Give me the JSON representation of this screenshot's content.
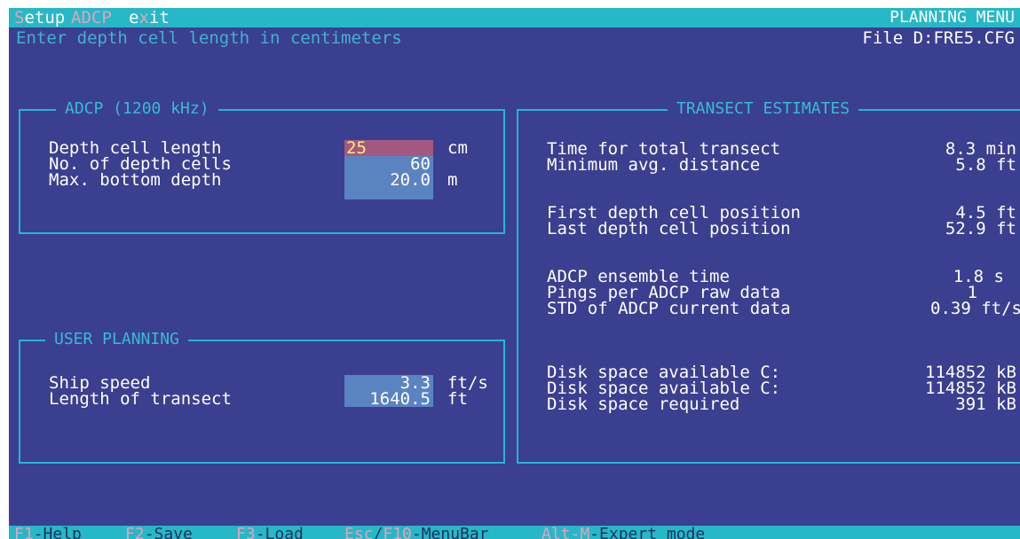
{
  "menu": {
    "setup_hot": "S",
    "setup_rest": "etup",
    "adcp": "ADCP",
    "exit_a": "e",
    "exit_hot": "x",
    "exit_b": "it",
    "title": "PLANNING MENU"
  },
  "hint": "Enter depth cell length in centimeters",
  "file": "File D:FRE5.CFG",
  "adcp_panel": {
    "title": "ADCP (1200 kHz)",
    "rows": [
      {
        "label": "Depth cell length",
        "value": "25",
        "unit": "cm"
      },
      {
        "label": "No. of depth cells",
        "value": "60",
        "unit": ""
      },
      {
        "label": "Max. bottom depth",
        "value": "20.0",
        "unit": "m"
      }
    ]
  },
  "user_panel": {
    "title": "USER PLANNING",
    "rows": [
      {
        "label": "Ship speed",
        "value": "3.3",
        "unit": "ft/s"
      },
      {
        "label": "Length of transect",
        "value": "1640.5",
        "unit": "ft"
      }
    ]
  },
  "transect_panel": {
    "title": "TRANSECT ESTIMATES",
    "rows": [
      {
        "label": "Time for total transect",
        "value": "8.3 min"
      },
      {
        "label": "Minimum avg. distance",
        "value": "5.8 ft"
      },
      {
        "label": "First depth cell position",
        "value": "4.5 ft"
      },
      {
        "label": "Last depth cell position",
        "value": "52.9 ft"
      },
      {
        "label": "ADCP ensemble time",
        "value": "1.8 s"
      },
      {
        "label": "Pings per ADCP raw data",
        "value": "1"
      },
      {
        "label": "STD of ADCP current data",
        "value": "0.39 ft/s"
      },
      {
        "label": "Disk space available C:",
        "value": "114852 kB"
      },
      {
        "label": "Disk space available C:",
        "value": "114852 kB"
      },
      {
        "label": "Disk space required",
        "value": "391 kB"
      }
    ]
  },
  "status": {
    "f1_key": "F1",
    "f1_txt": "-Help",
    "f2_key": "F2",
    "f2_txt": "-Save",
    "f3_key": "F3",
    "f3_txt": "-Load",
    "esc_key": "Esc",
    "slash": "/",
    "f10_key": "F10",
    "f10_txt": "-MenuBar",
    "altm_key": "Alt-M",
    "altm_txt": "-Expert mode"
  },
  "colors": {
    "screen_bg": "#3b3f8f",
    "bar_bg": "#27b8c8",
    "frame": "#23b7cf",
    "field_bg": "#5a83c2",
    "active_field_bg": "#a5587f",
    "hotkey": "#e8a0b8"
  }
}
